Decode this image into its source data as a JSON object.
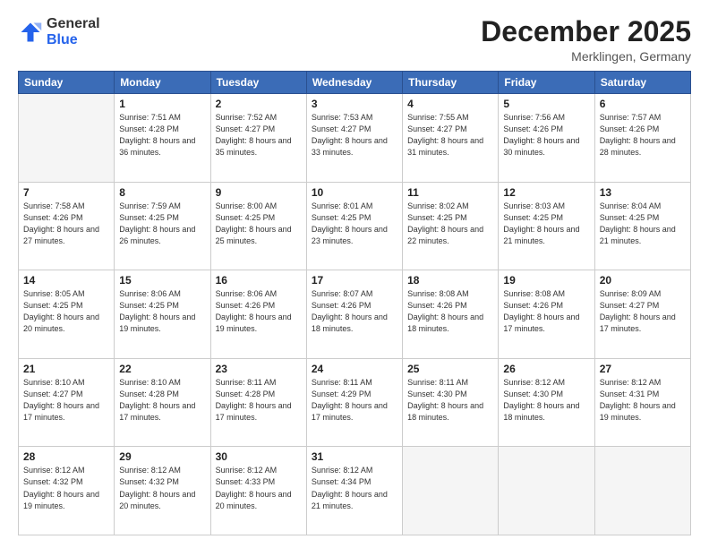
{
  "header": {
    "logo_general": "General",
    "logo_blue": "Blue",
    "month_title": "December 2025",
    "location": "Merklingen, Germany"
  },
  "weekdays": [
    "Sunday",
    "Monday",
    "Tuesday",
    "Wednesday",
    "Thursday",
    "Friday",
    "Saturday"
  ],
  "weeks": [
    [
      {
        "day": "",
        "empty": true
      },
      {
        "day": "1",
        "sunrise": "7:51 AM",
        "sunset": "4:28 PM",
        "daylight": "8 hours and 36 minutes."
      },
      {
        "day": "2",
        "sunrise": "7:52 AM",
        "sunset": "4:27 PM",
        "daylight": "8 hours and 35 minutes."
      },
      {
        "day": "3",
        "sunrise": "7:53 AM",
        "sunset": "4:27 PM",
        "daylight": "8 hours and 33 minutes."
      },
      {
        "day": "4",
        "sunrise": "7:55 AM",
        "sunset": "4:27 PM",
        "daylight": "8 hours and 31 minutes."
      },
      {
        "day": "5",
        "sunrise": "7:56 AM",
        "sunset": "4:26 PM",
        "daylight": "8 hours and 30 minutes."
      },
      {
        "day": "6",
        "sunrise": "7:57 AM",
        "sunset": "4:26 PM",
        "daylight": "8 hours and 28 minutes."
      }
    ],
    [
      {
        "day": "7",
        "sunrise": "7:58 AM",
        "sunset": "4:26 PM",
        "daylight": "8 hours and 27 minutes."
      },
      {
        "day": "8",
        "sunrise": "7:59 AM",
        "sunset": "4:25 PM",
        "daylight": "8 hours and 26 minutes."
      },
      {
        "day": "9",
        "sunrise": "8:00 AM",
        "sunset": "4:25 PM",
        "daylight": "8 hours and 25 minutes."
      },
      {
        "day": "10",
        "sunrise": "8:01 AM",
        "sunset": "4:25 PM",
        "daylight": "8 hours and 23 minutes."
      },
      {
        "day": "11",
        "sunrise": "8:02 AM",
        "sunset": "4:25 PM",
        "daylight": "8 hours and 22 minutes."
      },
      {
        "day": "12",
        "sunrise": "8:03 AM",
        "sunset": "4:25 PM",
        "daylight": "8 hours and 21 minutes."
      },
      {
        "day": "13",
        "sunrise": "8:04 AM",
        "sunset": "4:25 PM",
        "daylight": "8 hours and 21 minutes."
      }
    ],
    [
      {
        "day": "14",
        "sunrise": "8:05 AM",
        "sunset": "4:25 PM",
        "daylight": "8 hours and 20 minutes."
      },
      {
        "day": "15",
        "sunrise": "8:06 AM",
        "sunset": "4:25 PM",
        "daylight": "8 hours and 19 minutes."
      },
      {
        "day": "16",
        "sunrise": "8:06 AM",
        "sunset": "4:26 PM",
        "daylight": "8 hours and 19 minutes."
      },
      {
        "day": "17",
        "sunrise": "8:07 AM",
        "sunset": "4:26 PM",
        "daylight": "8 hours and 18 minutes."
      },
      {
        "day": "18",
        "sunrise": "8:08 AM",
        "sunset": "4:26 PM",
        "daylight": "8 hours and 18 minutes."
      },
      {
        "day": "19",
        "sunrise": "8:08 AM",
        "sunset": "4:26 PM",
        "daylight": "8 hours and 17 minutes."
      },
      {
        "day": "20",
        "sunrise": "8:09 AM",
        "sunset": "4:27 PM",
        "daylight": "8 hours and 17 minutes."
      }
    ],
    [
      {
        "day": "21",
        "sunrise": "8:10 AM",
        "sunset": "4:27 PM",
        "daylight": "8 hours and 17 minutes."
      },
      {
        "day": "22",
        "sunrise": "8:10 AM",
        "sunset": "4:28 PM",
        "daylight": "8 hours and 17 minutes."
      },
      {
        "day": "23",
        "sunrise": "8:11 AM",
        "sunset": "4:28 PM",
        "daylight": "8 hours and 17 minutes."
      },
      {
        "day": "24",
        "sunrise": "8:11 AM",
        "sunset": "4:29 PM",
        "daylight": "8 hours and 17 minutes."
      },
      {
        "day": "25",
        "sunrise": "8:11 AM",
        "sunset": "4:30 PM",
        "daylight": "8 hours and 18 minutes."
      },
      {
        "day": "26",
        "sunrise": "8:12 AM",
        "sunset": "4:30 PM",
        "daylight": "8 hours and 18 minutes."
      },
      {
        "day": "27",
        "sunrise": "8:12 AM",
        "sunset": "4:31 PM",
        "daylight": "8 hours and 19 minutes."
      }
    ],
    [
      {
        "day": "28",
        "sunrise": "8:12 AM",
        "sunset": "4:32 PM",
        "daylight": "8 hours and 19 minutes."
      },
      {
        "day": "29",
        "sunrise": "8:12 AM",
        "sunset": "4:32 PM",
        "daylight": "8 hours and 20 minutes."
      },
      {
        "day": "30",
        "sunrise": "8:12 AM",
        "sunset": "4:33 PM",
        "daylight": "8 hours and 20 minutes."
      },
      {
        "day": "31",
        "sunrise": "8:12 AM",
        "sunset": "4:34 PM",
        "daylight": "8 hours and 21 minutes."
      },
      {
        "day": "",
        "empty": true
      },
      {
        "day": "",
        "empty": true
      },
      {
        "day": "",
        "empty": true
      }
    ]
  ]
}
